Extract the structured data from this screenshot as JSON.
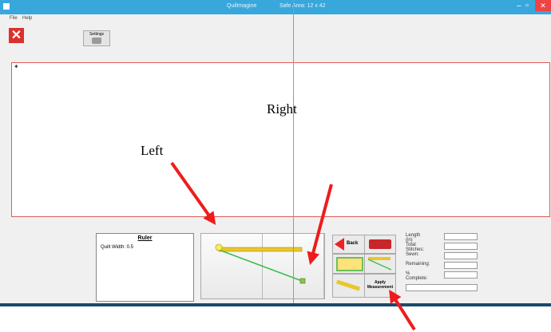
{
  "window": {
    "title": "Quiltmagine",
    "safe_area": "Safe Area: 12 x 42",
    "controls": [
      "–",
      "▫",
      "✕"
    ]
  },
  "menu": {
    "file": "File",
    "help": "Help"
  },
  "toolbar": {
    "close_glyph": "✕",
    "settings_label": "Settings"
  },
  "annotations": {
    "right": "Right",
    "left": "Left"
  },
  "ruler": {
    "title": "Ruler",
    "quilt_width": "Quilt Width: 0.5"
  },
  "actions": {
    "back": "Back",
    "apply": "Apply\nMeasurement"
  },
  "fields": [
    {
      "label": "Length (in)",
      "value": ""
    },
    {
      "label": "Total Stitches:",
      "value": ""
    },
    {
      "label": "Sewn:",
      "value": ""
    },
    {
      "label": "Remaining:",
      "value": ""
    },
    {
      "label": "% Complete:",
      "value": ""
    }
  ],
  "colors": {
    "titlebar": "#38a7dc",
    "close": "#d9312e",
    "quilt_border": "#e15a5a",
    "arrow": "#ee1c1c"
  }
}
